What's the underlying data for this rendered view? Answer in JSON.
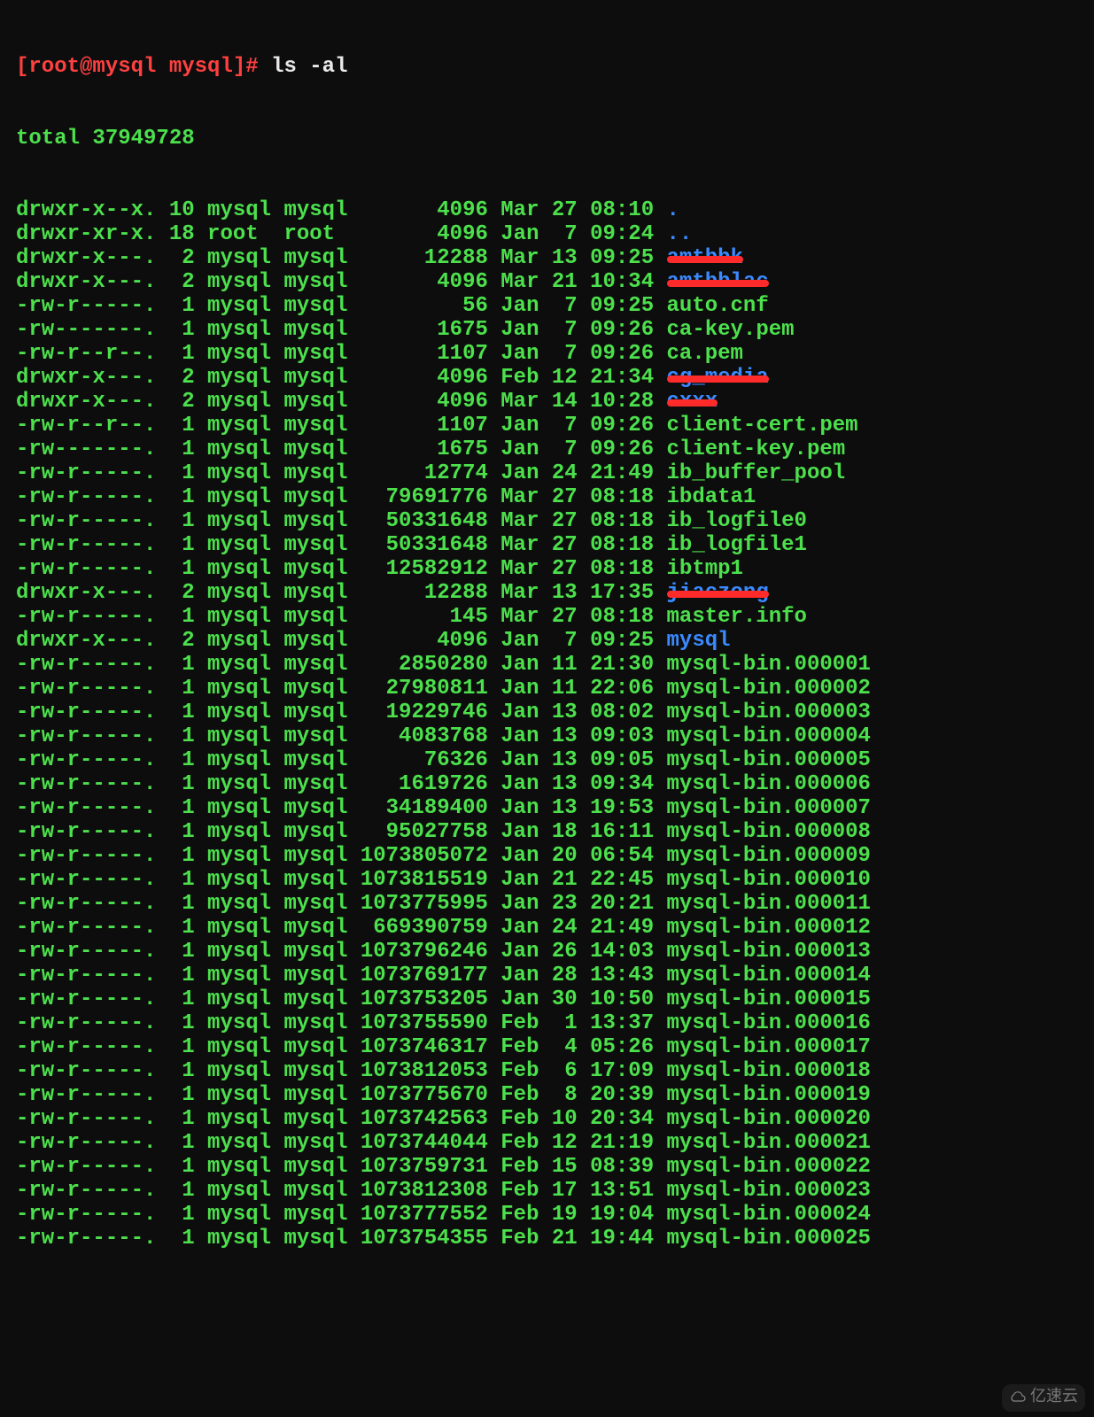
{
  "prompt": {
    "user_host": "[root@mysql mysql]#",
    "command": "ls -al"
  },
  "total_line": "total 37949728",
  "rows": [
    {
      "perm": "drwxr-x--x.",
      "links": "10",
      "owner": "mysql",
      "group": "mysql",
      "size": "4096",
      "date": "Mar 27 08:10",
      "name": ".",
      "cls": "dir"
    },
    {
      "perm": "drwxr-xr-x.",
      "links": "18",
      "owner": "root",
      "group": "root",
      "size": "4096",
      "date": "Jan  7 09:24",
      "name": "..",
      "cls": "dir"
    },
    {
      "perm": "drwxr-x---.",
      "links": "2",
      "owner": "mysql",
      "group": "mysql",
      "size": "12288",
      "date": "Mar 13 09:25",
      "name": "amtbbk",
      "cls": "redacted"
    },
    {
      "perm": "drwxr-x---.",
      "links": "2",
      "owner": "mysql",
      "group": "mysql",
      "size": "4096",
      "date": "Mar 21 10:34",
      "name": "amtbblac",
      "cls": "redacted"
    },
    {
      "perm": "-rw-r-----.",
      "links": "1",
      "owner": "mysql",
      "group": "mysql",
      "size": "56",
      "date": "Jan  7 09:25",
      "name": "auto.cnf",
      "cls": "green"
    },
    {
      "perm": "-rw-------.",
      "links": "1",
      "owner": "mysql",
      "group": "mysql",
      "size": "1675",
      "date": "Jan  7 09:26",
      "name": "ca-key.pem",
      "cls": "green"
    },
    {
      "perm": "-rw-r--r--.",
      "links": "1",
      "owner": "mysql",
      "group": "mysql",
      "size": "1107",
      "date": "Jan  7 09:26",
      "name": "ca.pem",
      "cls": "green"
    },
    {
      "perm": "drwxr-x---.",
      "links": "2",
      "owner": "mysql",
      "group": "mysql",
      "size": "4096",
      "date": "Feb 12 21:34",
      "name": "cg_media",
      "cls": "redacted"
    },
    {
      "perm": "drwxr-x---.",
      "links": "2",
      "owner": "mysql",
      "group": "mysql",
      "size": "4096",
      "date": "Mar 14 10:28",
      "name": "cxxx",
      "cls": "redacted"
    },
    {
      "perm": "-rw-r--r--.",
      "links": "1",
      "owner": "mysql",
      "group": "mysql",
      "size": "1107",
      "date": "Jan  7 09:26",
      "name": "client-cert.pem",
      "cls": "green"
    },
    {
      "perm": "-rw-------.",
      "links": "1",
      "owner": "mysql",
      "group": "mysql",
      "size": "1675",
      "date": "Jan  7 09:26",
      "name": "client-key.pem",
      "cls": "green"
    },
    {
      "perm": "-rw-r-----.",
      "links": "1",
      "owner": "mysql",
      "group": "mysql",
      "size": "12774",
      "date": "Jan 24 21:49",
      "name": "ib_buffer_pool",
      "cls": "green"
    },
    {
      "perm": "-rw-r-----.",
      "links": "1",
      "owner": "mysql",
      "group": "mysql",
      "size": "79691776",
      "date": "Mar 27 08:18",
      "name": "ibdata1",
      "cls": "green"
    },
    {
      "perm": "-rw-r-----.",
      "links": "1",
      "owner": "mysql",
      "group": "mysql",
      "size": "50331648",
      "date": "Mar 27 08:18",
      "name": "ib_logfile0",
      "cls": "green"
    },
    {
      "perm": "-rw-r-----.",
      "links": "1",
      "owner": "mysql",
      "group": "mysql",
      "size": "50331648",
      "date": "Mar 27 08:18",
      "name": "ib_logfile1",
      "cls": "green"
    },
    {
      "perm": "-rw-r-----.",
      "links": "1",
      "owner": "mysql",
      "group": "mysql",
      "size": "12582912",
      "date": "Mar 27 08:18",
      "name": "ibtmp1",
      "cls": "green"
    },
    {
      "perm": "drwxr-x---.",
      "links": "2",
      "owner": "mysql",
      "group": "mysql",
      "size": "12288",
      "date": "Mar 13 17:35",
      "name": "jiaczong",
      "cls": "redacted"
    },
    {
      "perm": "-rw-r-----.",
      "links": "1",
      "owner": "mysql",
      "group": "mysql",
      "size": "145",
      "date": "Mar 27 08:18",
      "name": "master.info",
      "cls": "green"
    },
    {
      "perm": "drwxr-x---.",
      "links": "2",
      "owner": "mysql",
      "group": "mysql",
      "size": "4096",
      "date": "Jan  7 09:25",
      "name": "mysql",
      "cls": "dir"
    },
    {
      "perm": "-rw-r-----.",
      "links": "1",
      "owner": "mysql",
      "group": "mysql",
      "size": "2850280",
      "date": "Jan 11 21:30",
      "name": "mysql-bin.000001",
      "cls": "green"
    },
    {
      "perm": "-rw-r-----.",
      "links": "1",
      "owner": "mysql",
      "group": "mysql",
      "size": "27980811",
      "date": "Jan 11 22:06",
      "name": "mysql-bin.000002",
      "cls": "green"
    },
    {
      "perm": "-rw-r-----.",
      "links": "1",
      "owner": "mysql",
      "group": "mysql",
      "size": "19229746",
      "date": "Jan 13 08:02",
      "name": "mysql-bin.000003",
      "cls": "green"
    },
    {
      "perm": "-rw-r-----.",
      "links": "1",
      "owner": "mysql",
      "group": "mysql",
      "size": "4083768",
      "date": "Jan 13 09:03",
      "name": "mysql-bin.000004",
      "cls": "green"
    },
    {
      "perm": "-rw-r-----.",
      "links": "1",
      "owner": "mysql",
      "group": "mysql",
      "size": "76326",
      "date": "Jan 13 09:05",
      "name": "mysql-bin.000005",
      "cls": "green"
    },
    {
      "perm": "-rw-r-----.",
      "links": "1",
      "owner": "mysql",
      "group": "mysql",
      "size": "1619726",
      "date": "Jan 13 09:34",
      "name": "mysql-bin.000006",
      "cls": "green"
    },
    {
      "perm": "-rw-r-----.",
      "links": "1",
      "owner": "mysql",
      "group": "mysql",
      "size": "34189400",
      "date": "Jan 13 19:53",
      "name": "mysql-bin.000007",
      "cls": "green"
    },
    {
      "perm": "-rw-r-----.",
      "links": "1",
      "owner": "mysql",
      "group": "mysql",
      "size": "95027758",
      "date": "Jan 18 16:11",
      "name": "mysql-bin.000008",
      "cls": "green"
    },
    {
      "perm": "-rw-r-----.",
      "links": "1",
      "owner": "mysql",
      "group": "mysql",
      "size": "1073805072",
      "date": "Jan 20 06:54",
      "name": "mysql-bin.000009",
      "cls": "green"
    },
    {
      "perm": "-rw-r-----.",
      "links": "1",
      "owner": "mysql",
      "group": "mysql",
      "size": "1073815519",
      "date": "Jan 21 22:45",
      "name": "mysql-bin.000010",
      "cls": "green"
    },
    {
      "perm": "-rw-r-----.",
      "links": "1",
      "owner": "mysql",
      "group": "mysql",
      "size": "1073775995",
      "date": "Jan 23 20:21",
      "name": "mysql-bin.000011",
      "cls": "green"
    },
    {
      "perm": "-rw-r-----.",
      "links": "1",
      "owner": "mysql",
      "group": "mysql",
      "size": "669390759",
      "date": "Jan 24 21:49",
      "name": "mysql-bin.000012",
      "cls": "green"
    },
    {
      "perm": "-rw-r-----.",
      "links": "1",
      "owner": "mysql",
      "group": "mysql",
      "size": "1073796246",
      "date": "Jan 26 14:03",
      "name": "mysql-bin.000013",
      "cls": "green"
    },
    {
      "perm": "-rw-r-----.",
      "links": "1",
      "owner": "mysql",
      "group": "mysql",
      "size": "1073769177",
      "date": "Jan 28 13:43",
      "name": "mysql-bin.000014",
      "cls": "green"
    },
    {
      "perm": "-rw-r-----.",
      "links": "1",
      "owner": "mysql",
      "group": "mysql",
      "size": "1073753205",
      "date": "Jan 30 10:50",
      "name": "mysql-bin.000015",
      "cls": "green"
    },
    {
      "perm": "-rw-r-----.",
      "links": "1",
      "owner": "mysql",
      "group": "mysql",
      "size": "1073755590",
      "date": "Feb  1 13:37",
      "name": "mysql-bin.000016",
      "cls": "green"
    },
    {
      "perm": "-rw-r-----.",
      "links": "1",
      "owner": "mysql",
      "group": "mysql",
      "size": "1073746317",
      "date": "Feb  4 05:26",
      "name": "mysql-bin.000017",
      "cls": "green"
    },
    {
      "perm": "-rw-r-----.",
      "links": "1",
      "owner": "mysql",
      "group": "mysql",
      "size": "1073812053",
      "date": "Feb  6 17:09",
      "name": "mysql-bin.000018",
      "cls": "green"
    },
    {
      "perm": "-rw-r-----.",
      "links": "1",
      "owner": "mysql",
      "group": "mysql",
      "size": "1073775670",
      "date": "Feb  8 20:39",
      "name": "mysql-bin.000019",
      "cls": "green"
    },
    {
      "perm": "-rw-r-----.",
      "links": "1",
      "owner": "mysql",
      "group": "mysql",
      "size": "1073742563",
      "date": "Feb 10 20:34",
      "name": "mysql-bin.000020",
      "cls": "green"
    },
    {
      "perm": "-rw-r-----.",
      "links": "1",
      "owner": "mysql",
      "group": "mysql",
      "size": "1073744044",
      "date": "Feb 12 21:19",
      "name": "mysql-bin.000021",
      "cls": "green"
    },
    {
      "perm": "-rw-r-----.",
      "links": "1",
      "owner": "mysql",
      "group": "mysql",
      "size": "1073759731",
      "date": "Feb 15 08:39",
      "name": "mysql-bin.000022",
      "cls": "green"
    },
    {
      "perm": "-rw-r-----.",
      "links": "1",
      "owner": "mysql",
      "group": "mysql",
      "size": "1073812308",
      "date": "Feb 17 13:51",
      "name": "mysql-bin.000023",
      "cls": "green"
    },
    {
      "perm": "-rw-r-----.",
      "links": "1",
      "owner": "mysql",
      "group": "mysql",
      "size": "1073777552",
      "date": "Feb 19 19:04",
      "name": "mysql-bin.000024",
      "cls": "green"
    },
    {
      "perm": "-rw-r-----.",
      "links": "1",
      "owner": "mysql",
      "group": "mysql",
      "size": "1073754355",
      "date": "Feb 21 19:44",
      "name": "mysql-bin.000025",
      "cls": "green"
    }
  ],
  "watermark": "亿速云"
}
